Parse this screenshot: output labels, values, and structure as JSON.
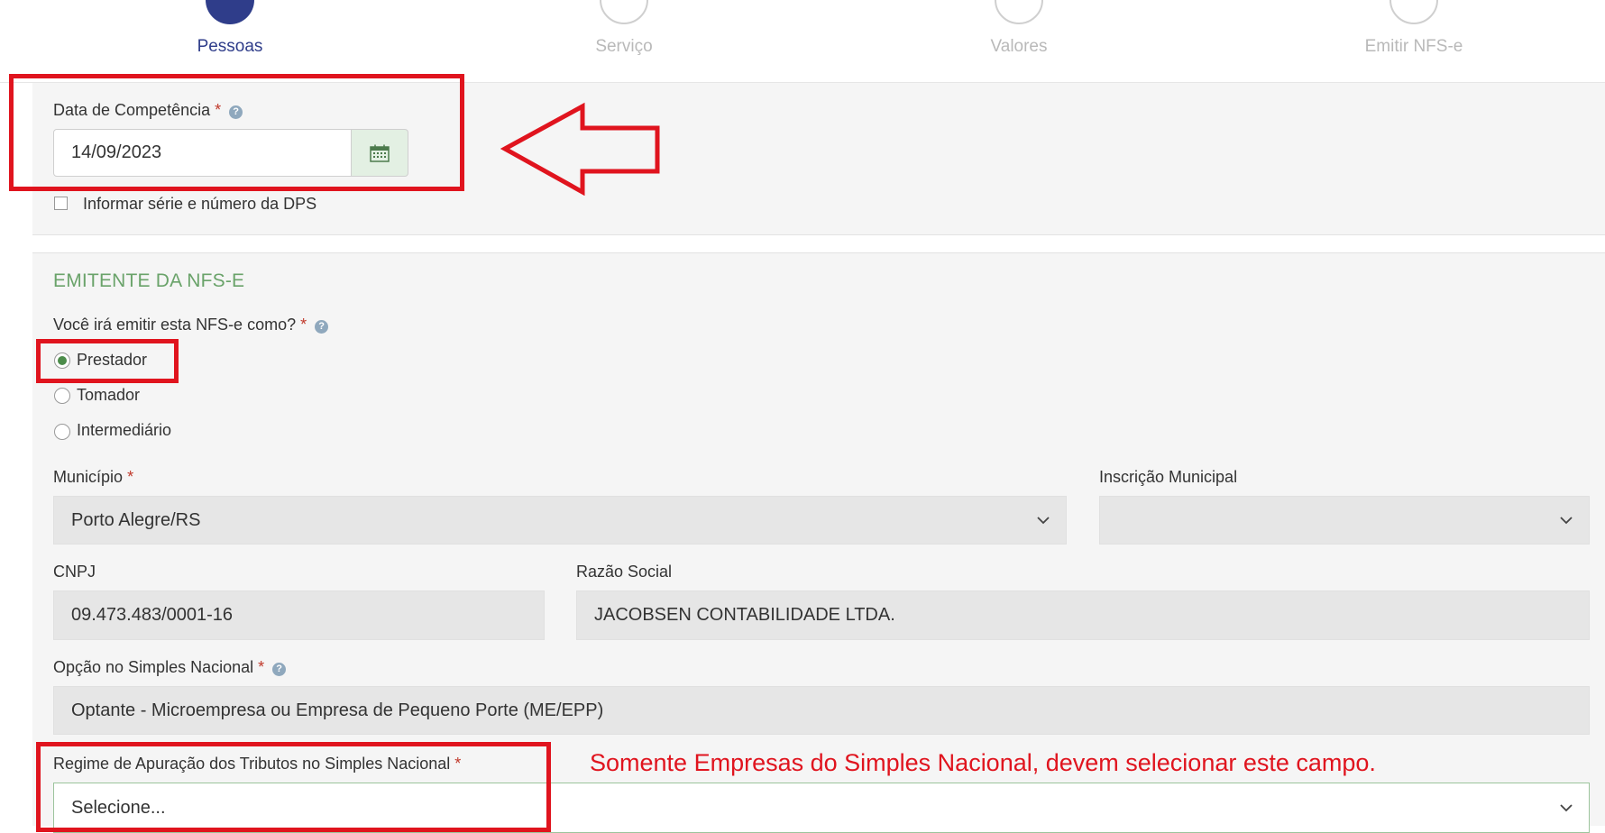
{
  "steps": [
    {
      "label": "Pessoas",
      "state": "active"
    },
    {
      "label": "Serviço",
      "state": "inactive"
    },
    {
      "label": "Valores",
      "state": "inactive"
    },
    {
      "label": "Emitir NFS-e",
      "state": "inactive"
    }
  ],
  "competencia": {
    "label": "Data de Competência",
    "required": "*",
    "value": "14/09/2023",
    "dps_checkbox_label": "Informar série e número da DPS",
    "dps_checked": false
  },
  "emitente": {
    "section_title": "EMITENTE DA NFS-E",
    "question": "Você irá emitir esta NFS-e como?",
    "required": "*",
    "options": [
      "Prestador",
      "Tomador",
      "Intermediário"
    ],
    "selected": "Prestador"
  },
  "municipio": {
    "label": "Município",
    "required": "*",
    "value": "Porto Alegre/RS"
  },
  "inscricao": {
    "label": "Inscrição Municipal",
    "value": ""
  },
  "cnpj": {
    "label": "CNPJ",
    "value": "09.473.483/0001-16"
  },
  "razao": {
    "label": "Razão Social",
    "value": "JACOBSEN CONTABILIDADE LTDA."
  },
  "simples": {
    "label": "Opção no Simples Nacional",
    "required": "*",
    "value": "Optante - Microempresa ou Empresa de Pequeno Porte (ME/EPP)"
  },
  "regime": {
    "label": "Regime de Apuração dos Tributos no Simples Nacional",
    "required": "*",
    "placeholder": "Selecione..."
  },
  "annotation": {
    "note": "Somente Empresas do Simples Nacional, devem selecionar este campo.",
    "color": "#e0141e"
  },
  "colors": {
    "accent": "#2f3d8a",
    "section": "#6aa36a",
    "annotation": "#e0141e"
  },
  "icons": {
    "calendar": "calendar-icon",
    "help": "question-circle-icon",
    "chevron": "chevron-down-icon"
  }
}
